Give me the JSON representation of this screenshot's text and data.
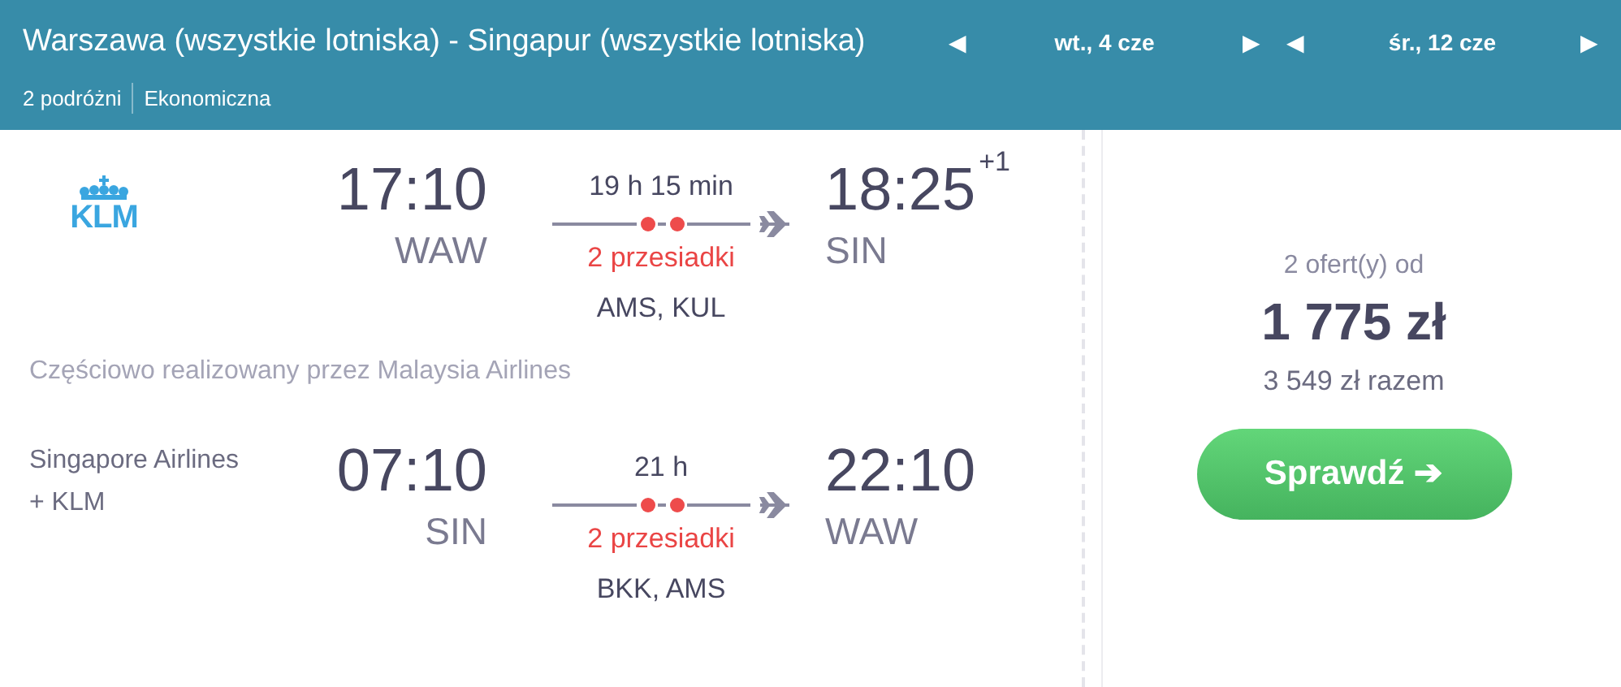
{
  "header": {
    "route": "Warszawa (wszystkie lotniska) - Singapur (wszystkie lotniska)",
    "travellers": "2 podróżni",
    "cabin": "Ekonomiczna",
    "dates": [
      {
        "label": "wt., 4 cze",
        "prev": "◀",
        "next": "▶"
      },
      {
        "label": "śr., 12 cze",
        "prev": "◀",
        "next": "▶"
      }
    ]
  },
  "flights": [
    {
      "carrier": {
        "kind": "logo",
        "name": "KLM"
      },
      "dep_time": "17:10",
      "dep_airport": "WAW",
      "duration": "19 h 15 min",
      "stops": "2 przesiadki",
      "via": "AMS, KUL",
      "arr_time": "18:25",
      "day_offset": "+1",
      "arr_airport": "SIN",
      "note": "Częściowo realizowany przez Malaysia Airlines"
    },
    {
      "carrier": {
        "kind": "text",
        "name": "Singapore Airlines + KLM"
      },
      "dep_time": "07:10",
      "dep_airport": "SIN",
      "duration": "21 h",
      "stops": "2 przesiadki",
      "via": "BKK, AMS",
      "arr_time": "22:10",
      "arr_airport": "WAW"
    }
  ],
  "offer": {
    "count": "2 ofert(y) od",
    "price": "1 775 zł",
    "total": "3 549 zł razem",
    "button": "Sprawdź",
    "button_icon": "➔"
  }
}
